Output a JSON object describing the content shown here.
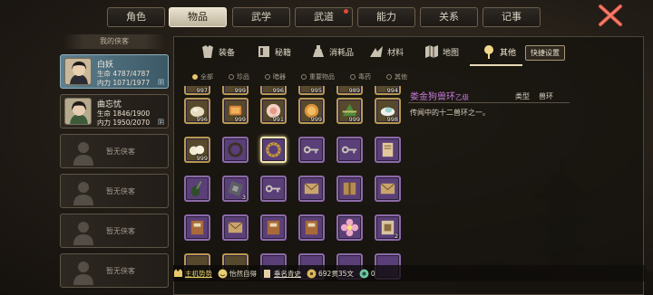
{
  "tabs": [
    {
      "label": "角色"
    },
    {
      "label": "物品"
    },
    {
      "label": "武学"
    },
    {
      "label": "武道"
    },
    {
      "label": "能力"
    },
    {
      "label": "关系"
    },
    {
      "label": "记事"
    }
  ],
  "sidebar": {
    "title": "我的侠客",
    "companions": [
      {
        "name": "白妖",
        "hp": "生命 4787/4787",
        "mp": "内力 1071/1977",
        "tag": "阴"
      },
      {
        "name": "曲忘忧",
        "hp": "生命 1846/1900",
        "mp": "内力 1950/2070",
        "tag": "阴"
      }
    ],
    "empty_label": "暂无侠客"
  },
  "categories": [
    {
      "label": "装备",
      "icon": "armor-icon"
    },
    {
      "label": "秘籍",
      "icon": "book-icon"
    },
    {
      "label": "消耗品",
      "icon": "potion-icon"
    },
    {
      "label": "材料",
      "icon": "material-icon"
    },
    {
      "label": "地图",
      "icon": "map-icon"
    },
    {
      "label": "其他",
      "icon": "other-icon"
    }
  ],
  "shortcut_label": "快捷设置",
  "filters": [
    {
      "label": "全部",
      "on": true
    },
    {
      "label": "珍品"
    },
    {
      "label": "暗器"
    },
    {
      "label": "重要物品"
    },
    {
      "label": "毒药"
    },
    {
      "label": "其他"
    }
  ],
  "grid": {
    "top_row": [
      "997",
      "999",
      "996",
      "995",
      "989",
      "994"
    ],
    "rows": [
      [
        {
          "kind": "gold",
          "icon": "bread-icon",
          "count": "996"
        },
        {
          "kind": "gold",
          "icon": "biscuit-icon",
          "count": "999"
        },
        {
          "kind": "gold",
          "icon": "peach-bun-icon",
          "count": "991"
        },
        {
          "kind": "gold",
          "icon": "mooncake-icon",
          "count": "999"
        },
        {
          "kind": "gold",
          "icon": "zongzi-icon",
          "count": "999"
        },
        {
          "kind": "gold",
          "icon": "dumpling-icon",
          "count": "998"
        }
      ],
      [
        {
          "kind": "gold",
          "icon": "buns-icon",
          "count": "999"
        },
        {
          "kind": "purple",
          "icon": "ring-icon",
          "count": ""
        },
        {
          "kind": "purple",
          "icon": "beast-ring-icon",
          "count": "",
          "sel": true
        },
        {
          "kind": "purple",
          "icon": "key-icon",
          "count": ""
        },
        {
          "kind": "purple",
          "icon": "key-icon",
          "count": ""
        },
        {
          "kind": "purple",
          "icon": "scroll-icon",
          "count": ""
        }
      ],
      [
        {
          "kind": "purple",
          "icon": "pipa-icon",
          "count": ""
        },
        {
          "kind": "purple",
          "icon": "token-icon",
          "count": "3"
        },
        {
          "kind": "purple",
          "icon": "key-icon",
          "count": ""
        },
        {
          "kind": "purple",
          "icon": "letter-icon",
          "count": ""
        },
        {
          "kind": "purple",
          "icon": "parcel-icon",
          "count": ""
        },
        {
          "kind": "purple",
          "icon": "letter-icon",
          "count": ""
        }
      ],
      [
        {
          "kind": "purple",
          "icon": "book-icon",
          "count": ""
        },
        {
          "kind": "purple",
          "icon": "letter-icon",
          "count": ""
        },
        {
          "kind": "purple",
          "icon": "book-icon",
          "count": ""
        },
        {
          "kind": "purple",
          "icon": "book-icon",
          "count": ""
        },
        {
          "kind": "purple",
          "icon": "flower-icon",
          "count": ""
        },
        {
          "kind": "purple",
          "icon": "card-icon",
          "count": "2"
        }
      ]
    ]
  },
  "detail": {
    "name": "娄金狗兽环",
    "grade": "乙级",
    "type_label": "类型",
    "type_value": "兽环",
    "description": "传闻中的十二兽环之一。"
  },
  "bottom": [
    {
      "label": "主机势势",
      "icon": "leader-icon"
    },
    {
      "label": "怡然自得",
      "icon": "smile-icon"
    },
    {
      "label": "垂名青史",
      "icon": "scroll-icon"
    },
    {
      "label": "692贯35文",
      "icon": "coin-icon"
    },
    {
      "label": "0",
      "icon": "jade-icon"
    }
  ],
  "colors": {
    "accent": "#e5d9b6",
    "rare": "#c57bd8",
    "gold_slot": "#b89a52",
    "purple_slot": "#8c6aa8"
  }
}
